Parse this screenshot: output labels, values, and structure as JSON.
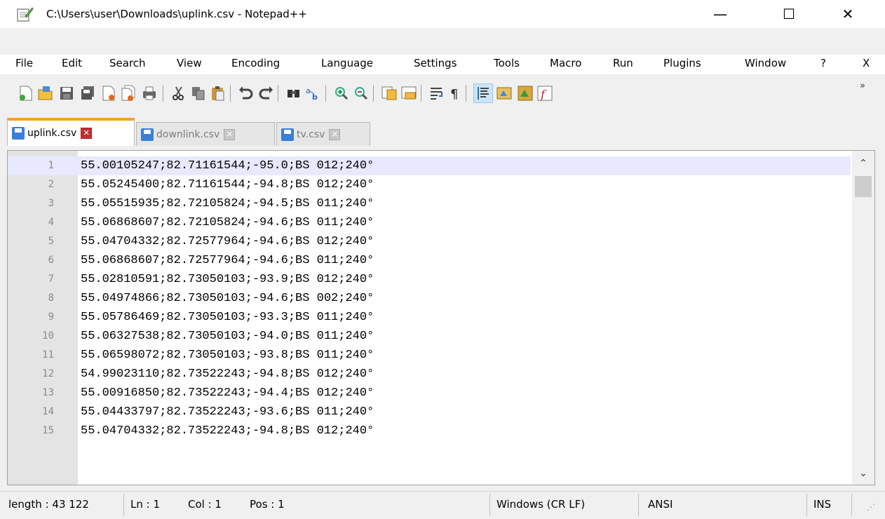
{
  "window": {
    "title": "C:\\Users\\user\\Downloads\\uplink.csv - Notepad++",
    "controls": {
      "minimize": "—",
      "maximize": "☐",
      "close": "✕"
    }
  },
  "menu": [
    "File",
    "Edit",
    "Search",
    "View",
    "Encoding",
    "Language",
    "Settings",
    "Tools",
    "Macro",
    "Run",
    "Plugins",
    "Window",
    "?",
    "X"
  ],
  "toolbar": {
    "icons": [
      "new-file-icon",
      "open-file-icon",
      "save-icon",
      "save-all-icon",
      "close-icon",
      "close-all-icon",
      "print-icon",
      "cut-icon",
      "copy-icon",
      "paste-icon",
      "undo-icon",
      "redo-icon",
      "find-icon",
      "replace-icon",
      "zoom-in-icon",
      "zoom-out-icon",
      "sync-vertical-icon",
      "sync-horizontal-icon",
      "word-wrap-icon",
      "show-all-chars-icon",
      "indent-guide-icon",
      "user-language-icon",
      "document-map-icon",
      "function-list-icon"
    ],
    "overflow": "»"
  },
  "tabs": [
    {
      "label": "uplink.csv",
      "active": true
    },
    {
      "label": "downlink.csv",
      "active": false
    },
    {
      "label": "tv.csv",
      "active": false
    }
  ],
  "editor": {
    "lines": [
      {
        "n": "1",
        "text": "55.00105247;82.71161544;-95.0;BS 012;240°"
      },
      {
        "n": "2",
        "text": "55.05245400;82.71161544;-94.8;BS 012;240°"
      },
      {
        "n": "3",
        "text": "55.05515935;82.72105824;-94.5;BS 011;240°"
      },
      {
        "n": "4",
        "text": "55.06868607;82.72105824;-94.6;BS 011;240°"
      },
      {
        "n": "5",
        "text": "55.04704332;82.72577964;-94.6;BS 012;240°"
      },
      {
        "n": "6",
        "text": "55.06868607;82.72577964;-94.6;BS 011;240°"
      },
      {
        "n": "7",
        "text": "55.02810591;82.73050103;-93.9;BS 012;240°"
      },
      {
        "n": "8",
        "text": "55.04974866;82.73050103;-94.6;BS 002;240°"
      },
      {
        "n": "9",
        "text": "55.05786469;82.73050103;-93.3;BS 011;240°"
      },
      {
        "n": "10",
        "text": "55.06327538;82.73050103;-94.0;BS 011;240°"
      },
      {
        "n": "11",
        "text": "55.06598072;82.73050103;-93.8;BS 011;240°"
      },
      {
        "n": "12",
        "text": "54.99023110;82.73522243;-94.8;BS 012;240°"
      },
      {
        "n": "13",
        "text": "55.00916850;82.73522243;-94.4;BS 012;240°"
      },
      {
        "n": "14",
        "text": "55.04433797;82.73522243;-93.6;BS 011;240°"
      },
      {
        "n": "15",
        "text": "55.04704332;82.73522243;-94.8;BS 012;240°"
      }
    ]
  },
  "status": {
    "length": "length : 43 122",
    "ln": "Ln : 1",
    "col": "Col : 1",
    "pos": "Pos : 1",
    "eol": "Windows (CR LF)",
    "encoding": "ANSI",
    "mode": "INS"
  }
}
